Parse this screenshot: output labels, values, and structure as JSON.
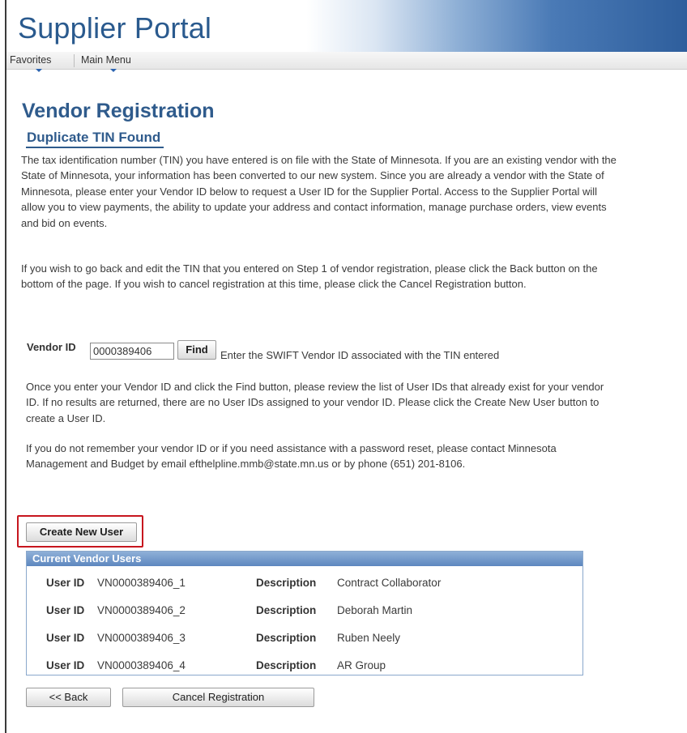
{
  "header": {
    "title": "Supplier Portal",
    "menu": {
      "favorites": "Favorites",
      "main_menu": "Main Menu"
    }
  },
  "page": {
    "title": "Vendor Registration",
    "subtitle": "Duplicate TIN Found",
    "paragraph1": "The tax identification number (TIN) you have entered is on file with the State of Minnesota. If you are an existing vendor with the State of Minnesota, your information has been converted to our new system. Since you are already a vendor with the State of Minnesota, please enter your Vendor ID below to request a User ID for the Supplier Portal. Access to the Supplier Portal will allow you to view payments, the ability to update your address and contact information, manage purchase orders, view events and bid on events.",
    "paragraph2": "If you wish to go back and edit the TIN that you entered on Step 1 of vendor registration, please click the Back button on the bottom of the page. If you wish to cancel registration at this time, please click the Cancel Registration button."
  },
  "vendor_lookup": {
    "label": "Vendor ID",
    "value": "0000389406",
    "find_label": "Find",
    "help_text": "Enter the SWIFT Vendor ID associated with the TIN entered"
  },
  "instructions": {
    "paragraph3": "Once you enter your Vendor ID and click the Find button, please review the list of User IDs that already exist for your vendor ID. If no results are returned, there are no User IDs assigned to your vendor ID. Please click the Create New User button to create a User ID.",
    "paragraph4": "If you do not remember your vendor ID or if you need assistance with a password reset, please contact Minnesota Management and Budget by email efthelpline.mmb@state.mn.us or by phone (651) 201-8106."
  },
  "actions": {
    "create_new_user": "Create New User",
    "back": "<< Back",
    "cancel_registration": "Cancel Registration"
  },
  "current_users": {
    "header": "Current Vendor Users",
    "user_id_label": "User ID",
    "description_label": "Description",
    "rows": [
      {
        "user_id": "VN0000389406_1",
        "description": "Contract Collaborator"
      },
      {
        "user_id": "VN0000389406_2",
        "description": "Deborah Martin"
      },
      {
        "user_id": "VN0000389406_3",
        "description": "Ruben Neely"
      },
      {
        "user_id": "VN0000389406_4",
        "description": "AR Group"
      }
    ]
  },
  "colors": {
    "title_blue": "#2f5b8c",
    "highlight_red": "#c7161e",
    "grid_header": "#6e95c8"
  }
}
